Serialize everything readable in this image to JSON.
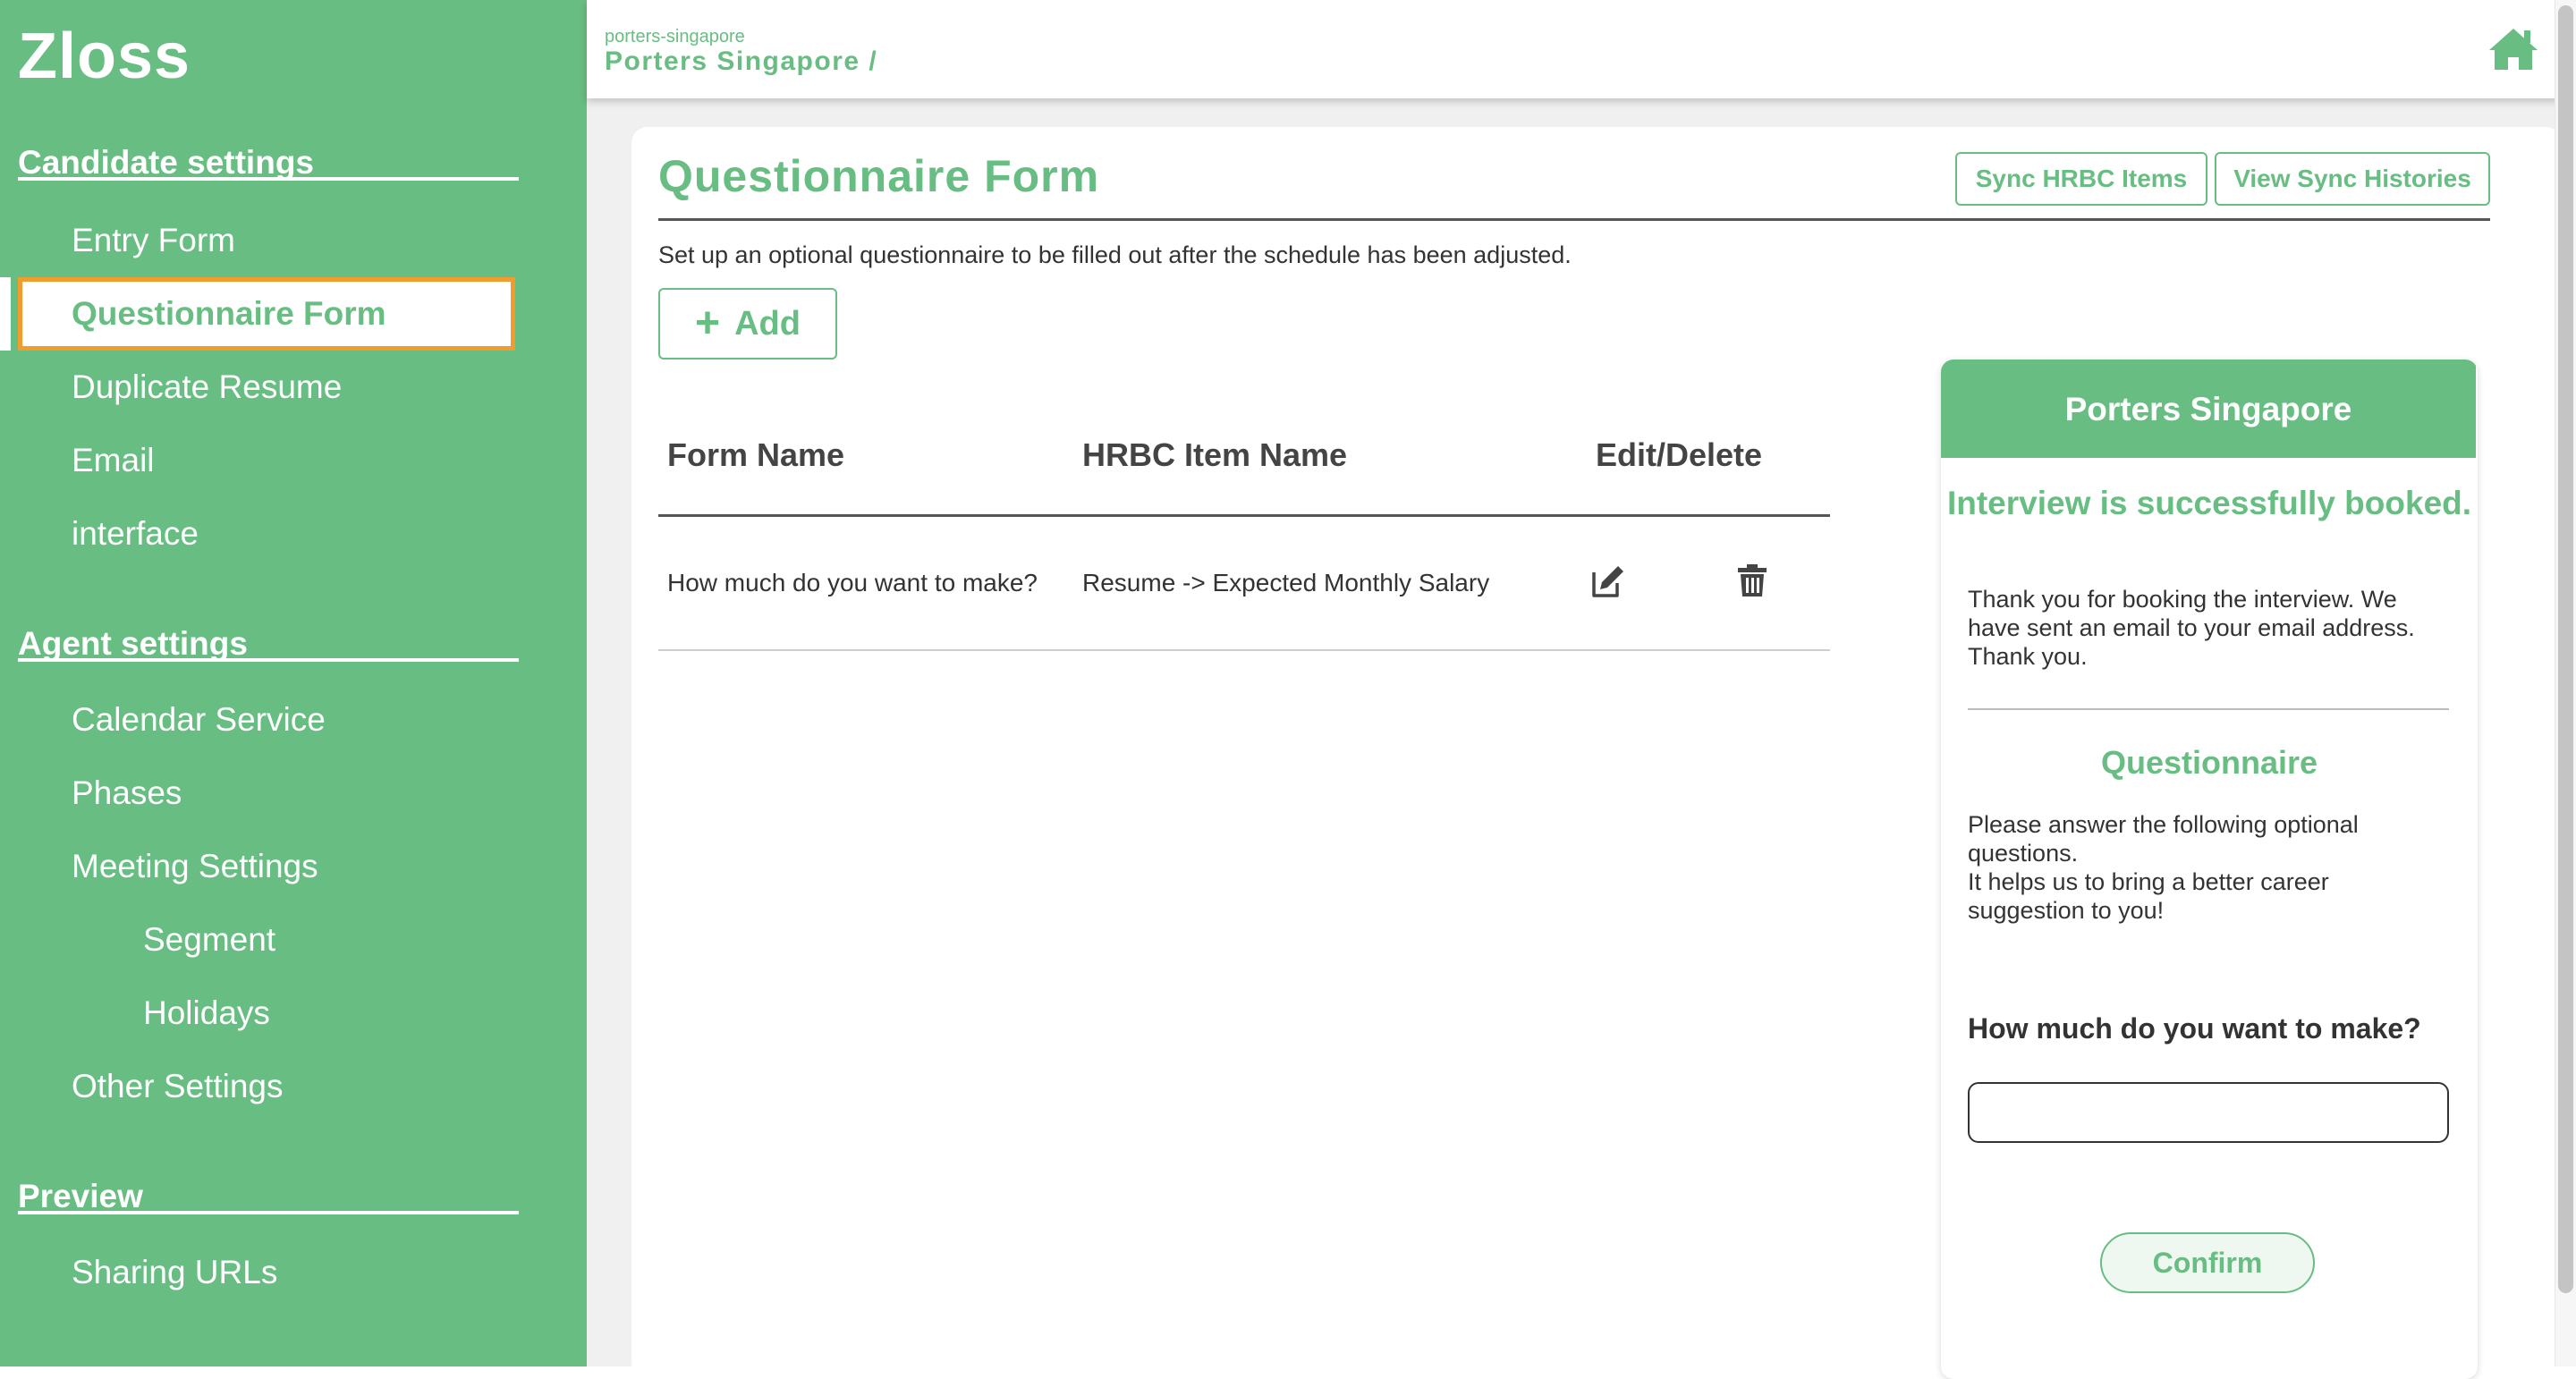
{
  "app": {
    "brand": "Zloss"
  },
  "sidebar": {
    "sections": [
      {
        "title": "Candidate settings",
        "items": [
          "Entry Form",
          "Questionnaire Form",
          "Duplicate Resume",
          "Email",
          "interface"
        ]
      },
      {
        "title": "Agent settings",
        "items": [
          "Calendar Service",
          "Phases",
          "Meeting Settings",
          "Segment",
          "Holidays",
          "Other Settings"
        ]
      },
      {
        "title": "Preview",
        "items": [
          "Sharing URLs"
        ]
      }
    ],
    "active_item": "Questionnaire Form"
  },
  "header": {
    "breadcrumb_small": "porters-singapore",
    "breadcrumb_main": "Porters Singapore /"
  },
  "page": {
    "title": "Questionnaire Form",
    "sync_button": "Sync HRBC Items",
    "histories_button": "View Sync Histories",
    "description": "Set up an optional questionnaire to be filled out after the schedule has been adjusted.",
    "add_button": "Add"
  },
  "table": {
    "columns": [
      "Form Name",
      "HRBC Item Name",
      "Edit/Delete"
    ],
    "rows": [
      {
        "form_name": "How much do you want to make?",
        "hrbc_item": "Resume -> Expected Monthly Salary"
      }
    ]
  },
  "preview": {
    "company": "Porters Singapore",
    "success_title": "Interview is successfully booked.",
    "thanks_text": "Thank you for booking the interview. We have sent an email to your email address. Thank you.",
    "questionnaire_title": "Questionnaire",
    "questionnaire_desc_1": "Please answer the following optional questions.",
    "questionnaire_desc_2": "It helps us to bring a better career suggestion to you!",
    "question": "How much do you want to make?",
    "input_value": "",
    "confirm_button": "Confirm"
  },
  "colors": {
    "accent": "#68bd82",
    "active_outline": "#f39c2e"
  }
}
